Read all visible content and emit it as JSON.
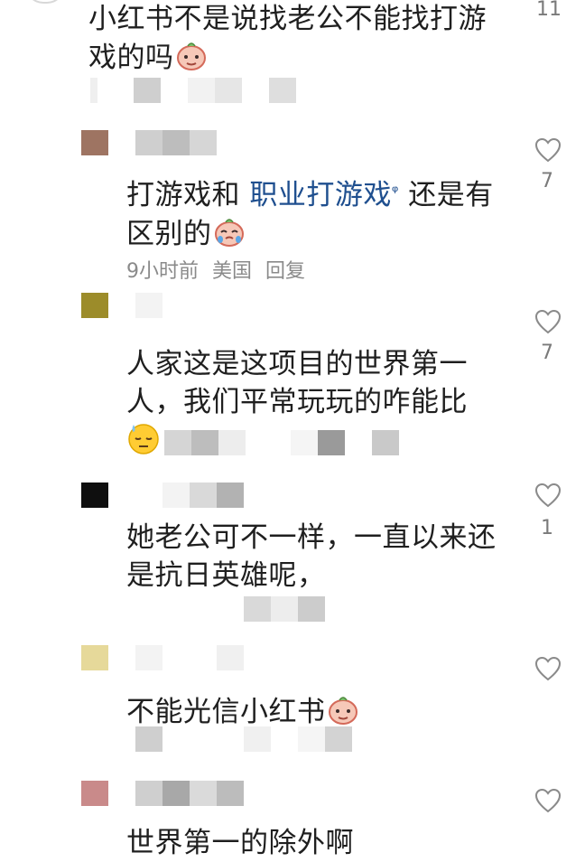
{
  "comments": [
    {
      "text": "小红书不是说找老公不能找打游戏的吗",
      "like_count": "11"
    },
    {
      "avatar_color": "#9e7462",
      "text_prefix": "打游戏和 ",
      "link": "职业打游戏",
      "link_suffix": "ᵠ",
      "text_suffix": " 还是有区别的",
      "meta_time": "9小时前",
      "meta_location": "美国",
      "meta_reply": "回复",
      "like_count": "7"
    },
    {
      "avatar_color": "#9c8c2a",
      "text": "人家这是这项目的世界第一人，我们平常玩玩的咋能比",
      "like_count": "7"
    },
    {
      "avatar_color": "#0f0f0f",
      "text": "她老公可不一样，一直以来还是抗日英雄呢，",
      "like_count": "1"
    },
    {
      "avatar_color": "#e6d99a",
      "text": "不能光信小红书",
      "like_count": ""
    },
    {
      "avatar_color": "#c98a8a",
      "text": "世界第一的除外啊",
      "like_count": ""
    }
  ],
  "icons": {
    "like": "heart-outline-icon",
    "emoji_peach": "peach-face-emoji-icon",
    "emoji_sweat": "sweat-face-emoji-icon"
  }
}
